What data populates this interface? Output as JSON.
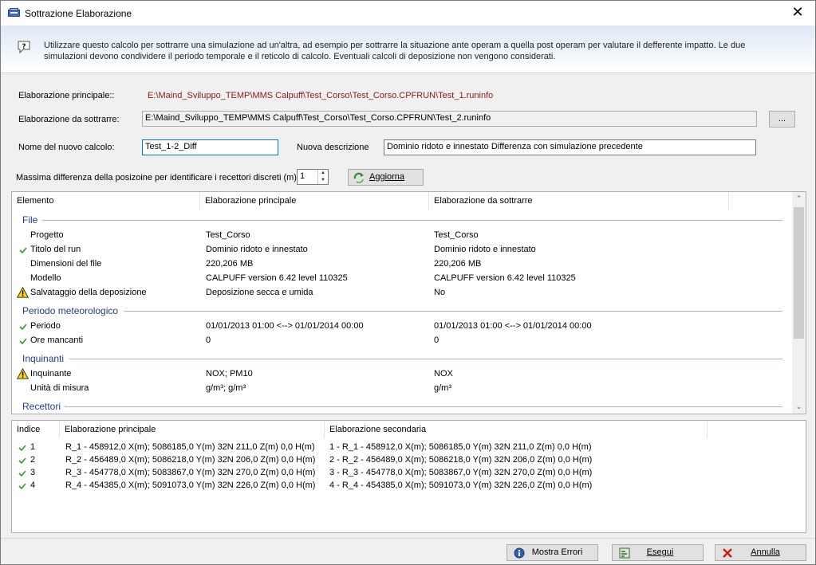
{
  "window": {
    "title": "Sottrazione Elaborazione"
  },
  "info": {
    "text": "Utilizzare questo calcolo per sottrarre una simulazione ad un'altra, ad esempio per sottrarre la situazione ante operam a quella post operam per valutare il defferente impatto. Le due simulazioni devono condividere il periodo temporale e il reticolo di calcolo. Eventuali calcoli di deposizione non vengono considerati."
  },
  "form": {
    "main_label": "Elaborazione principale::",
    "main_path": "E:\\Maind_Sviluppo_TEMP\\MMS Calpuff\\Test_Corso\\Test_Corso.CPFRUN\\Test_1.runinfo",
    "sub_label": "Elaborazione da sottrarre:",
    "sub_path": "E:\\Maind_Sviluppo_TEMP\\MMS Calpuff\\Test_Corso\\Test_Corso.CPFRUN\\Test_2.runinfo",
    "browse_label": "...",
    "name_label": "Nome del nuovo calcolo:",
    "name_value": "Test_1-2_Diff",
    "desc_label": "Nuova descrizione",
    "desc_value": "Dominio ridoto e innestato Differenza con simulazione precedente",
    "maxdiff_label": "Massima differenza della posizoine per identificare i recettori discreti  (m):",
    "maxdiff_value": "1",
    "refresh_label": "Aggiorna"
  },
  "compare": {
    "headers": [
      "Elemento",
      "Elaborazione principale",
      "Elaborazione da sottrarre"
    ],
    "groups": [
      {
        "title": "File",
        "rows": [
          {
            "status": "none",
            "label": "Progetto",
            "main": "Test_Corso",
            "sub": "Test_Corso"
          },
          {
            "status": "ok",
            "label": "Titolo del run",
            "main": "Dominio ridoto e innestato",
            "sub": "Dominio ridoto e innestato"
          },
          {
            "status": "none",
            "label": "Dimensioni del file",
            "main": "220,206 MB",
            "sub": "220,206 MB"
          },
          {
            "status": "none",
            "label": "Modello",
            "main": "CALPUFF version 6.42 level 110325",
            "sub": "CALPUFF version 6.42 level 110325"
          },
          {
            "status": "warn",
            "label": "Salvataggio della deposizione",
            "main": "Deposizione secca e umida",
            "sub": "No"
          }
        ]
      },
      {
        "title": "Periodo meteorologico",
        "rows": [
          {
            "status": "ok",
            "label": "Periodo",
            "main": "01/01/2013 01:00 <--> 01/01/2014 00:00",
            "sub": "01/01/2013 01:00 <--> 01/01/2014 00:00"
          },
          {
            "status": "ok",
            "label": "Ore mancanti",
            "main": "0",
            "sub": "0"
          }
        ]
      },
      {
        "title": "Inquinanti",
        "rows": [
          {
            "status": "warn",
            "label": "Inquinante",
            "main": "NOX; PM10",
            "sub": "NOX"
          },
          {
            "status": "none",
            "label": "Unità di misura",
            "main": "g/m³; g/m³",
            "sub": "g/m³"
          }
        ]
      },
      {
        "title": "Recettori",
        "rows": []
      }
    ]
  },
  "receptors": {
    "headers": [
      "Indice",
      "Elaborazione principale",
      "Elaborazione secondaria"
    ],
    "rows": [
      {
        "index": "1",
        "main": "R_1 - 458912,0 X(m); 5086185,0 Y(m) 32N  211,0 Z(m) 0,0 H(m)",
        "sub": "1 - R_1 - 458912,0 X(m); 5086185,0 Y(m) 32N  211,0 Z(m) 0,0 H(m)"
      },
      {
        "index": "2",
        "main": "R_2 - 456489,0 X(m); 5086218,0 Y(m) 32N  206,0 Z(m) 0,0 H(m)",
        "sub": "2 - R_2 - 456489,0 X(m); 5086218,0 Y(m) 32N  206,0 Z(m) 0,0 H(m)"
      },
      {
        "index": "3",
        "main": "R_3 - 454778,0 X(m); 5083867,0 Y(m) 32N  270,0 Z(m) 0,0 H(m)",
        "sub": "3 - R_3 - 454778,0 X(m); 5083867,0 Y(m) 32N  270,0 Z(m) 0,0 H(m)"
      },
      {
        "index": "4",
        "main": "R_4 - 454385,0 X(m); 5091073,0 Y(m) 32N  226,0 Z(m) 0,0 H(m)",
        "sub": "4 - R_4 - 454385,0 X(m); 5091073,0 Y(m) 32N  226,0 Z(m) 0,0 H(m)"
      }
    ]
  },
  "footer": {
    "errors_label": "Mostra Errori",
    "run_label": "Esegui",
    "cancel_label": "Annulla"
  }
}
